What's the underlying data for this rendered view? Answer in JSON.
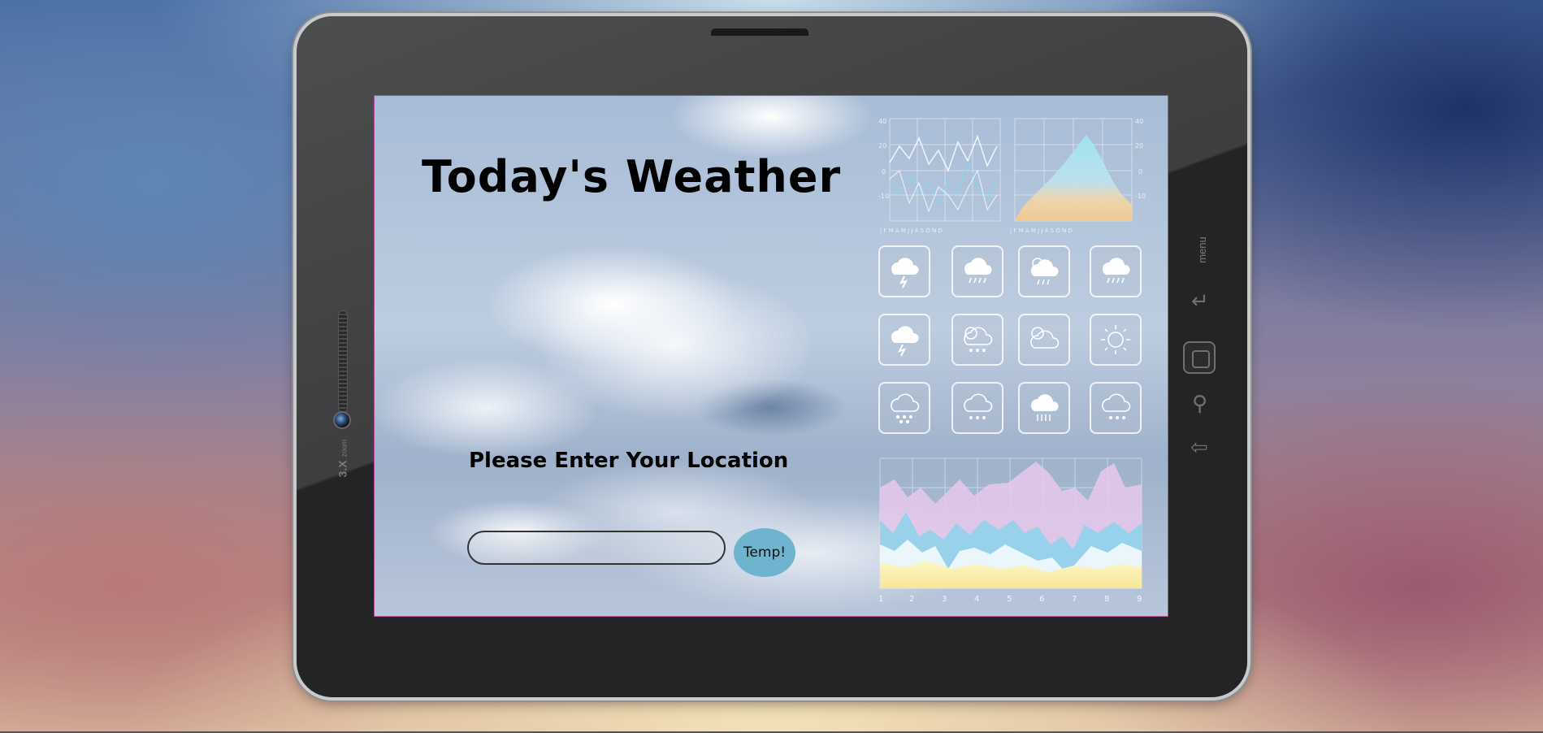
{
  "app": {
    "title": "Today's Weather",
    "prompt": "Please Enter Your Location",
    "location_input": {
      "value": "",
      "placeholder": ""
    },
    "temp_button_label": "Temp!"
  },
  "device": {
    "zoom_label": "3.X",
    "zoom_sub": "zoom",
    "menu_label": "menu"
  },
  "infographic": {
    "line_chart_y_ticks": [
      "40",
      "20",
      "0",
      "-10"
    ],
    "line_chart_y_ticks_right": [
      "40",
      "20",
      "0",
      "-10"
    ],
    "area_chart_x_ticks": [
      "1",
      "2",
      "3",
      "4",
      "5",
      "6",
      "7",
      "8",
      "9"
    ],
    "month_ticks": "J F M A M J J A S O N D",
    "weather_icons": [
      "thunderstorm-cloud-icon",
      "rain-cloud-icon",
      "sun-rain-cloud-icon",
      "rain-cloud-icon",
      "lightning-cloud-icon",
      "sun-snow-cloud-icon",
      "partly-cloudy-icon",
      "sun-icon",
      "snow-cloud-icon",
      "snow-cloud-icon",
      "heavy-rain-cloud-icon",
      "snow-cloud-icon"
    ]
  },
  "colors": {
    "button": "#6fb4cf",
    "screen_border": "#b04d9a"
  }
}
